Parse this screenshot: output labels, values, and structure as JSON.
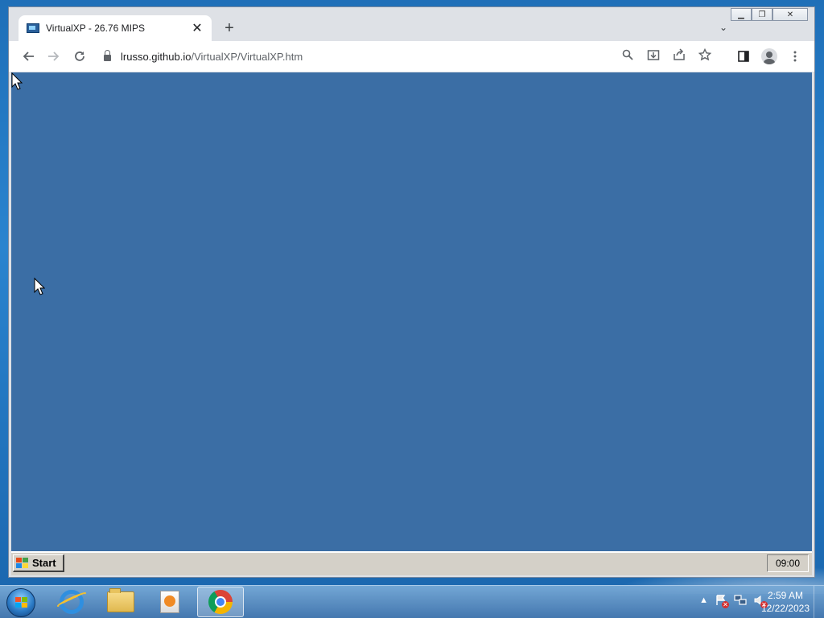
{
  "browser": {
    "tab_title": "VirtualXP - 26.76 MIPS",
    "tab_close": "✕",
    "new_tab": "+",
    "url_host": "lrusso.github.io",
    "url_path": "/VirtualXP/VirtualXP.htm",
    "icons": [
      "back-icon",
      "forward-icon",
      "reload-icon",
      "lock-icon",
      "zoom-icon",
      "install-icon",
      "share-icon",
      "bookmark-star-icon",
      "side-panel-icon",
      "profile-icon",
      "menu-icon"
    ]
  },
  "emulator": {
    "desktop_color": "#3b6ea5",
    "start_label": "Start",
    "clock": "09:00"
  },
  "windows_taskbar": {
    "time": "2:59 AM",
    "date": "12/22/2023",
    "pinned": [
      "internet-explorer",
      "windows-explorer",
      "media-player",
      "google-chrome"
    ],
    "active": "google-chrome"
  }
}
